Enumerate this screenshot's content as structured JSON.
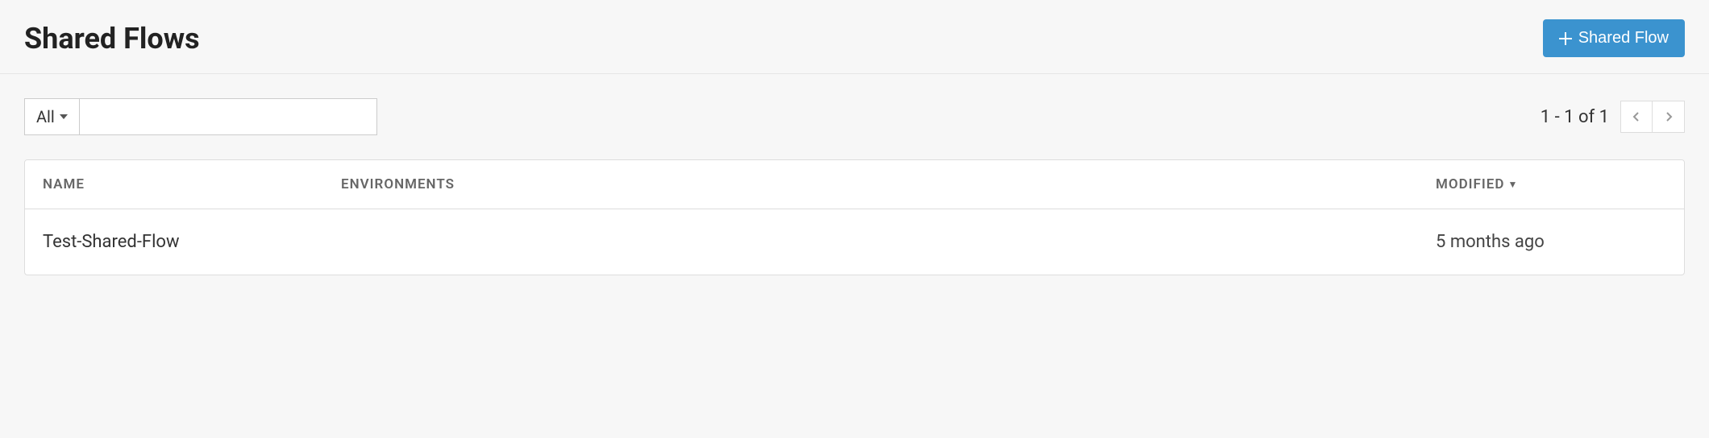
{
  "header": {
    "title": "Shared Flows",
    "create_button_label": "Shared Flow"
  },
  "filter": {
    "dropdown_selected": "All",
    "search_value": ""
  },
  "pagination": {
    "status": "1 - 1 of 1"
  },
  "table": {
    "columns": {
      "name": "NAME",
      "environments": "ENVIRONMENTS",
      "modified": "MODIFIED"
    },
    "sort_indicator": "▼",
    "rows": [
      {
        "name": "Test-Shared-Flow",
        "environments": "",
        "modified": "5 months ago"
      }
    ]
  }
}
